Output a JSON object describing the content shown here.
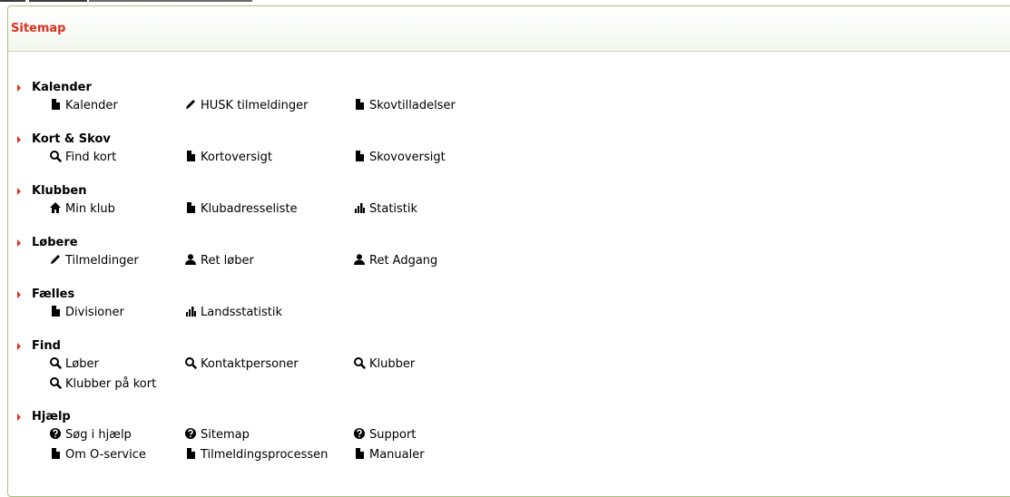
{
  "panel": {
    "title": "Sitemap"
  },
  "sections": [
    {
      "title": "Kalender",
      "links": [
        {
          "label": "Kalender",
          "icon": "file-icon"
        },
        {
          "label": "HUSK tilmeldinger",
          "icon": "pencil-icon"
        },
        {
          "label": "Skovtilladelser",
          "icon": "file-icon"
        }
      ]
    },
    {
      "title": "Kort & Skov",
      "links": [
        {
          "label": "Find kort",
          "icon": "search-icon"
        },
        {
          "label": "Kortoversigt",
          "icon": "file-icon"
        },
        {
          "label": "Skovoversigt",
          "icon": "file-icon"
        }
      ]
    },
    {
      "title": "Klubben",
      "links": [
        {
          "label": "Min klub",
          "icon": "home-icon"
        },
        {
          "label": "Klubadresseliste",
          "icon": "file-icon"
        },
        {
          "label": "Statistik",
          "icon": "bar-chart-icon"
        }
      ]
    },
    {
      "title": "Løbere",
      "links": [
        {
          "label": "Tilmeldinger",
          "icon": "pencil-icon"
        },
        {
          "label": "Ret løber",
          "icon": "user-icon"
        },
        {
          "label": "Ret Adgang",
          "icon": "user-icon"
        }
      ]
    },
    {
      "title": "Fælles",
      "links": [
        {
          "label": "Divisioner",
          "icon": "file-icon"
        },
        {
          "label": "Landsstatistik",
          "icon": "bar-chart-icon"
        }
      ]
    },
    {
      "title": "Find",
      "links": [
        {
          "label": "Løber",
          "icon": "search-icon"
        },
        {
          "label": "Kontaktpersoner",
          "icon": "search-icon"
        },
        {
          "label": "Klubber",
          "icon": "search-icon"
        },
        {
          "label": "Klubber på kort",
          "icon": "search-icon"
        }
      ]
    },
    {
      "title": "Hjælp",
      "links": [
        {
          "label": "Søg i hjælp",
          "icon": "help-icon"
        },
        {
          "label": "Sitemap",
          "icon": "help-icon"
        },
        {
          "label": "Support",
          "icon": "help-icon"
        },
        {
          "label": "Om O-service",
          "icon": "file-icon"
        },
        {
          "label": "Tilmeldingsprocessen",
          "icon": "file-icon"
        },
        {
          "label": "Manualer",
          "icon": "file-icon"
        }
      ]
    }
  ],
  "colors": {
    "accent": "#e0301e",
    "border": "#a8c07a"
  }
}
